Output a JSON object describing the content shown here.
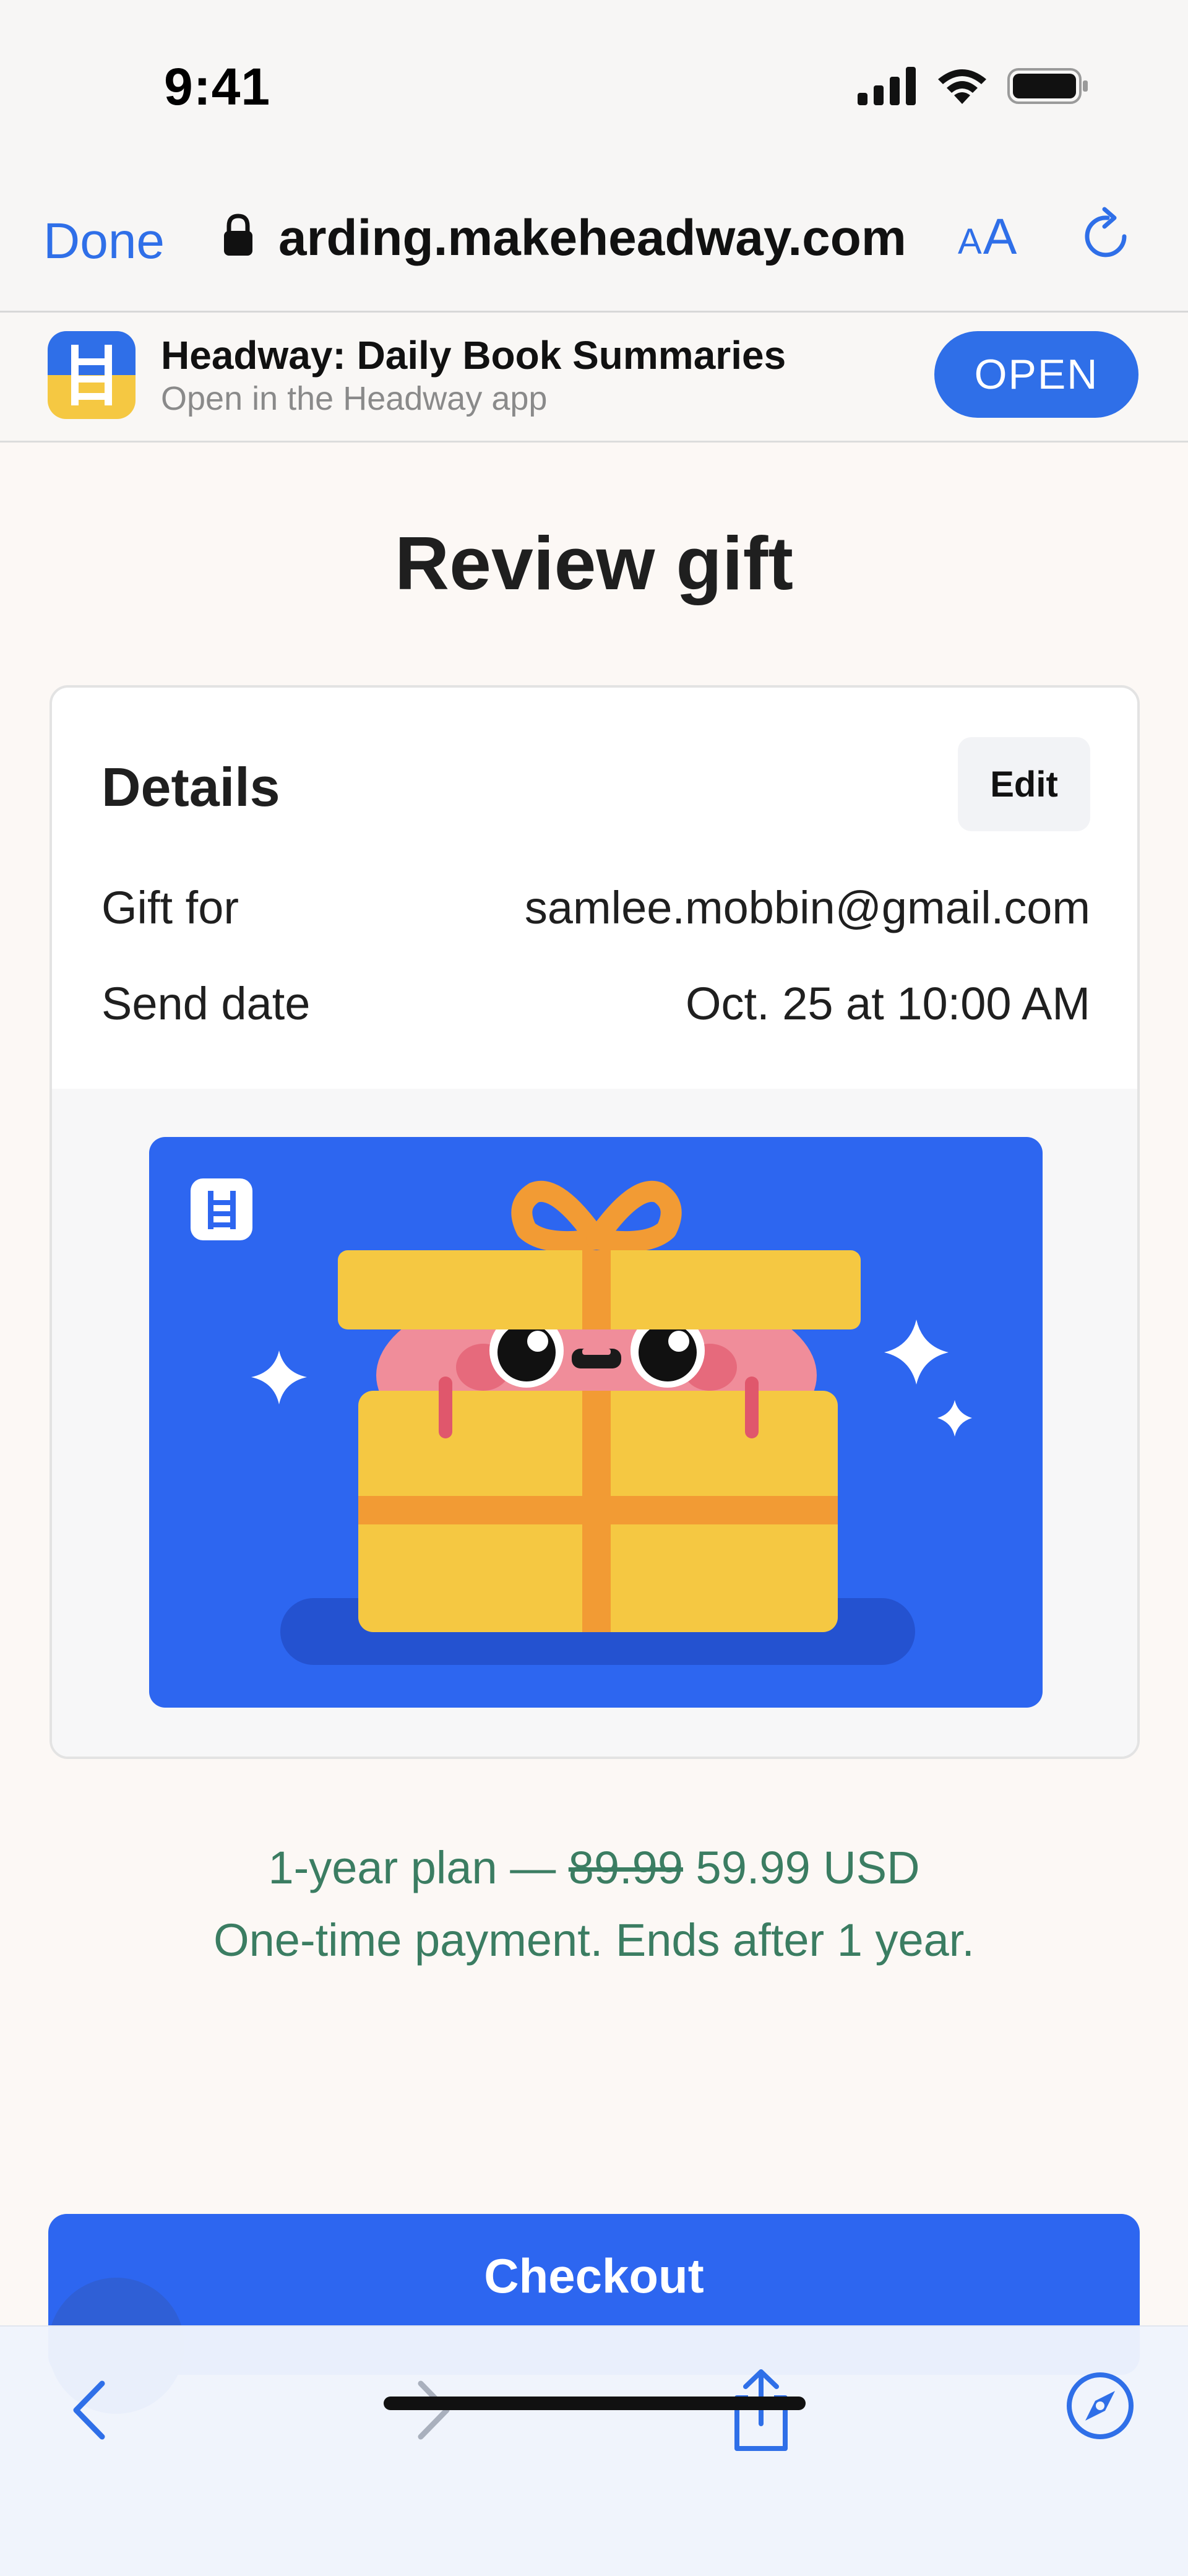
{
  "status_bar": {
    "time": "9:41"
  },
  "browser": {
    "done_label": "Done",
    "url": "arding.makeheadway.com",
    "text_size_label_small": "A",
    "text_size_label_large": "A"
  },
  "app_banner": {
    "title": "Headway: Daily Book Summaries",
    "subtitle": "Open in the Headway app",
    "open_label": "OPEN"
  },
  "page": {
    "title": "Review gift"
  },
  "details": {
    "title": "Details",
    "edit_label": "Edit",
    "gift_for_label": "Gift for",
    "gift_for_value": "samlee.mobbin@gmail.com",
    "send_date_label": "Send date",
    "send_date_value": "Oct. 25 at 10:00 AM"
  },
  "pricing": {
    "plan": "1-year plan —",
    "old_price": "89.99",
    "new_price": "59.99 USD",
    "note": "One-time payment. Ends after 1 year."
  },
  "checkout": {
    "label": "Checkout"
  },
  "colors": {
    "brand_blue": "#2d66f0",
    "accent_link": "#2f6fe8",
    "price_green": "#3b7d62",
    "gift_yellow": "#f5c842",
    "ribbon_orange": "#f29b34"
  },
  "icons": {
    "status": [
      "cellular-signal-icon",
      "wifi-icon",
      "battery-icon"
    ],
    "toolbar": [
      "back-arrow-icon",
      "forward-arrow-icon",
      "share-icon",
      "compass-icon"
    ]
  }
}
